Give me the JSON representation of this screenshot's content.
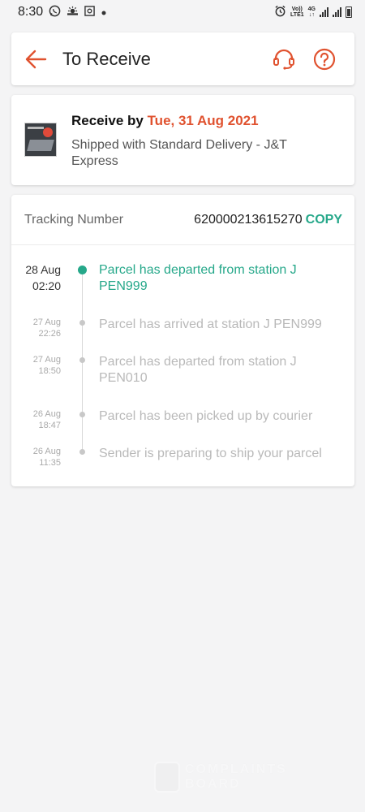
{
  "status_bar": {
    "time": "8:30",
    "icons": [
      "whatsapp-icon",
      "weather-icon",
      "screenshot-icon",
      "dot-icon"
    ],
    "right_icons": [
      "alarm-icon",
      "volte-icon",
      "signal-icon",
      "battery-icon"
    ],
    "volte_top": "Vo))",
    "volte_bottom": "LTE1",
    "net_top": "4G",
    "net_bottom": "↓↑"
  },
  "header": {
    "title": "To Receive",
    "back_icon": "arrow-left-icon",
    "support_icon": "headset-icon",
    "help_icon": "question-circle-icon",
    "accent": "#e0522f"
  },
  "delivery": {
    "receive_prefix": "Receive by ",
    "receive_date": "Tue, 31 Aug 2021",
    "shipping_text": "Shipped with Standard Delivery  - J&T Express"
  },
  "tracking": {
    "label": "Tracking Number",
    "number": "620000213615270",
    "copy_label": "COPY",
    "accent": "#26a88a",
    "events": [
      {
        "date": "28 Aug",
        "time": "02:20",
        "text": "Parcel has departed from station J PEN999",
        "active": true
      },
      {
        "date": "27 Aug",
        "time": "22:26",
        "text": "Parcel has arrived at station J PEN999",
        "active": false
      },
      {
        "date": "27 Aug",
        "time": "18:50",
        "text": "Parcel has departed from station J PEN010",
        "active": false
      },
      {
        "date": "26 Aug",
        "time": "18:47",
        "text": "Parcel has been picked up by courier",
        "active": false
      },
      {
        "date": "26 Aug",
        "time": "11:35",
        "text": "Sender is preparing to ship your parcel",
        "active": false
      }
    ]
  },
  "watermark": {
    "line1": "COMPLAINTS",
    "line2": "BOARD"
  }
}
